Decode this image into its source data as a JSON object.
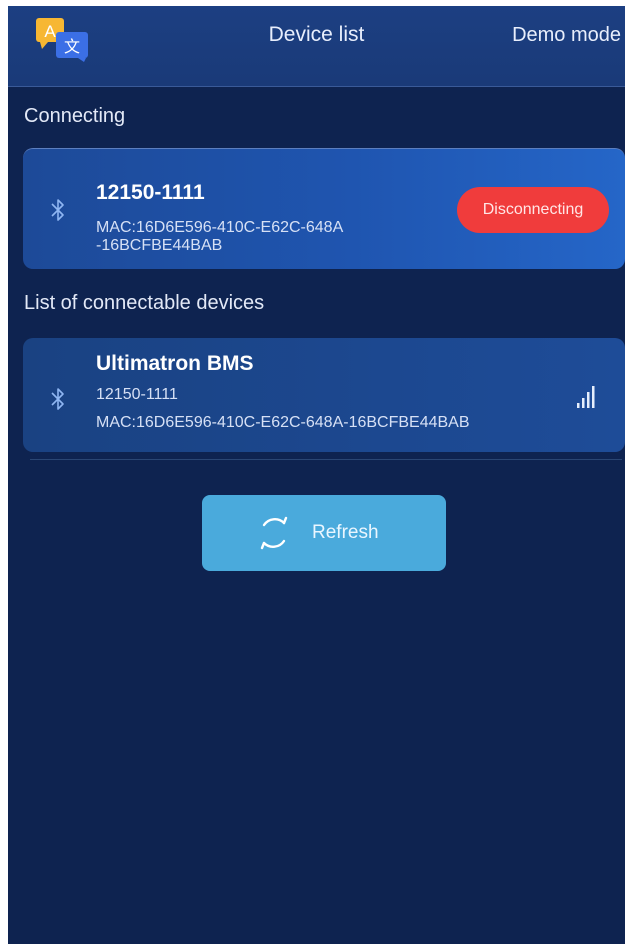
{
  "header": {
    "title": "Device list",
    "demo_mode": "Demo mode",
    "translate_icon": "translate-icon"
  },
  "connecting": {
    "section_label": "Connecting",
    "device": {
      "name": "12150-1111",
      "mac": "MAC:16D6E596-410C-E62C-648A-16BCFBE44BAB",
      "action_label": "Disconnecting",
      "icon": "bluetooth-icon"
    }
  },
  "connectable": {
    "section_label": "List of connectable devices",
    "devices": [
      {
        "name": "Ultimatron BMS",
        "id": "12150-1111",
        "mac": "MAC:16D6E596-410C-E62C-648A-16BCFBE44BAB",
        "icon": "bluetooth-icon",
        "signal_icon": "signal-strength-icon"
      }
    ]
  },
  "refresh": {
    "label": "Refresh",
    "icon": "refresh-icon"
  },
  "colors": {
    "background": "#0e2350",
    "header": "#1a3a78",
    "card_connected": "#1f55b0",
    "card_connectable": "#1c4890",
    "disconnect": "#f03c3c",
    "refresh": "#4aaadc"
  }
}
